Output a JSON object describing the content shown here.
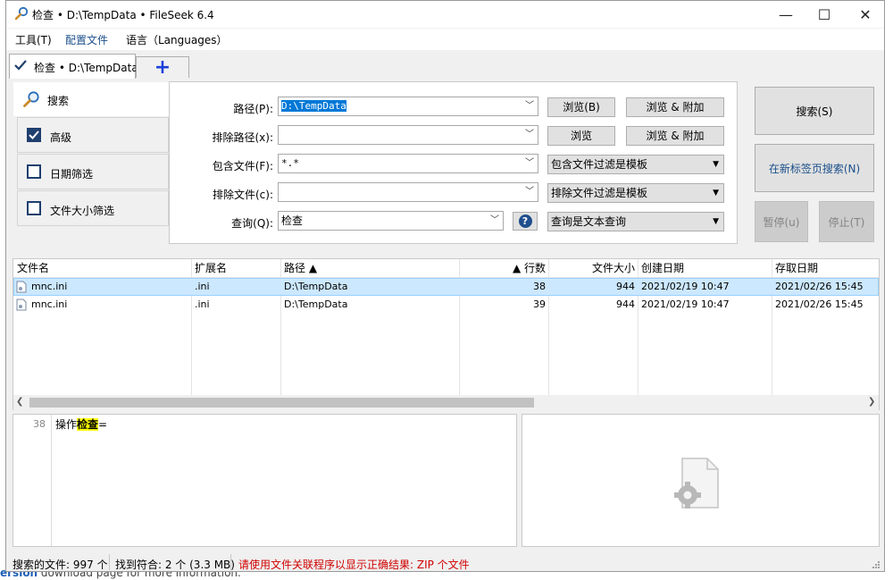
{
  "background": {
    "bottom_prefix": "ersion",
    "bottom_text": " download page for more information."
  },
  "titlebar": {
    "title": "检查 • D:\\TempData • FileSeek 6.4",
    "minimize": "—",
    "maximize": "☐",
    "close": "✕"
  },
  "menu": {
    "items": [
      "工具(T)",
      "配置文件",
      "语言（Languages）"
    ]
  },
  "tabs": {
    "active_label": "检查 • D:\\TempData",
    "add_label": "+"
  },
  "sidebar": {
    "search_label": "搜索",
    "items": [
      {
        "label": "高级",
        "checked": true
      },
      {
        "label": "日期筛选",
        "checked": false
      },
      {
        "label": "文件大小筛选",
        "checked": false
      }
    ]
  },
  "form": {
    "path_label": "路径(P):",
    "path_value": "D:\\TempData",
    "exclude_path_label": "排除路径(x):",
    "exclude_path_value": "",
    "include_files_label": "包含文件(F):",
    "include_files_value": "*.*",
    "exclude_files_label": "排除文件(c):",
    "exclude_files_value": "",
    "query_label": "查询(Q):",
    "query_value": "检查",
    "browse_b": "浏览(B)",
    "browse_append_1": "浏览 & 附加",
    "browse": "浏览",
    "browse_append_2": "浏览 & 附加",
    "include_filter": "包含文件过滤是模板",
    "exclude_filter": "排除文件过滤是模板",
    "query_type": "查询是文本查询",
    "help": "?"
  },
  "actions": {
    "search": "搜索(S)",
    "search_new_tab": "在新标签页搜索(N)",
    "pause": "暂停(u)",
    "stop": "停止(T)"
  },
  "results": {
    "columns": [
      "文件名",
      "扩展名",
      "路径 ▲",
      "▲ 行数",
      "文件大小",
      "创建日期",
      "存取日期"
    ],
    "rows": [
      {
        "name": "mnc.ini",
        "ext": ".ini",
        "path": "D:\\TempData",
        "line": "38",
        "size": "944",
        "created": "2021/02/19 10:47",
        "accessed": "2021/02/26 15:45"
      },
      {
        "name": "mnc.ini",
        "ext": ".ini",
        "path": "D:\\TempData",
        "line": "39",
        "size": "944",
        "created": "2021/02/19 10:47",
        "accessed": "2021/02/26 15:45"
      }
    ]
  },
  "preview": {
    "line_number": "38",
    "text_before": "操作",
    "highlight": "检查",
    "text_after": "="
  },
  "status": {
    "searched": "搜索的文件: 997 个",
    "found": "找到符合: 2 个 (3.3 MB)",
    "warning": "请使用文件关联程序以显示正确结果: ZIP 个文件"
  },
  "colors": {
    "selected_row": "#cce8ff",
    "highlight": "#ffff00",
    "warning": "#d00000",
    "accent": "#1a3fd8"
  }
}
